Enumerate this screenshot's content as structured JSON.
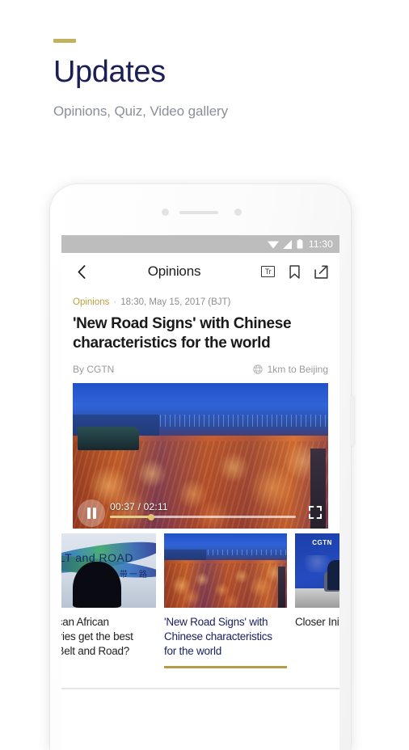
{
  "page": {
    "title": "Updates",
    "subtitle": "Opinions, Quiz, Video gallery",
    "accent_color": "#c2b15d",
    "title_color": "#1b1f56",
    "subtitle_color": "#8b8f9a"
  },
  "phone": {
    "status_bar": {
      "time": "11:30",
      "wifi_icon": "wifi-icon",
      "signal_icon": "signal-icon",
      "battery_icon": "battery-icon",
      "background_color": "#bdbdbd"
    },
    "app_bar": {
      "back_icon": "chevron-left-icon",
      "title": "Opinions",
      "text_size_label": "Tr",
      "text_size_icon": "text-size-icon",
      "bookmark_icon": "bookmark-icon",
      "share_icon": "share-external-icon"
    },
    "article": {
      "category": "Opinions",
      "separator": "·",
      "timestamp": "18:30, May 15, 2017 (BJT)",
      "headline": "'New Road Signs' with Chinese characteristics for the world",
      "byline": "By CGTN",
      "location_icon": "globe-icon",
      "location": "1km to Beijing",
      "category_color": "#b9a33f"
    },
    "video": {
      "play_state_icon": "pause-icon",
      "current_time": "00:37",
      "time_separator": "/",
      "duration": "02:11",
      "time_display": "00:37 / 02:11",
      "progress_percent": 22,
      "fullscreen_icon": "fullscreen-icon",
      "progress_color": "#e2d08a"
    },
    "carousel": {
      "active_underline_color": "#b79a46",
      "cards": [
        {
          "title": "How can African countries get the best from Belt and Road?",
          "thumb": "belt-and-road-banner",
          "thumb_text": "BELT and ROAD",
          "thumb_text_cn": "一带一路",
          "active": false
        },
        {
          "title": "'New Road Signs' with Chinese characteristics for the world",
          "thumb": "container-port-night",
          "active": true
        },
        {
          "title": "Closer Initiative",
          "thumb": "cgtn-panel-discussion",
          "thumb_text": "CGTN",
          "active": false
        }
      ]
    }
  }
}
